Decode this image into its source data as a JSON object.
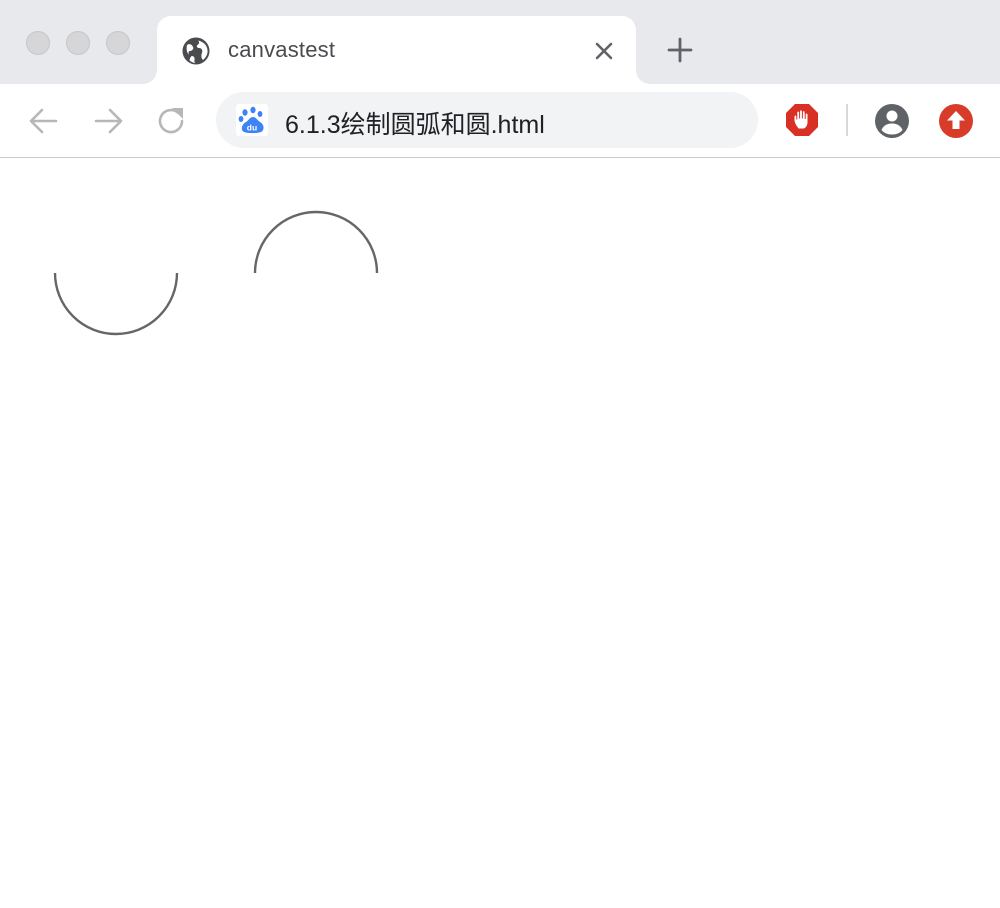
{
  "window": {
    "traffic_lights": [
      "close",
      "minimize",
      "maximize"
    ]
  },
  "tab": {
    "title": "canvastest",
    "favicon": "globe-icon",
    "close_icon": "close-icon"
  },
  "new_tab": {
    "icon": "plus-icon"
  },
  "toolbar": {
    "back_icon": "arrow-left-icon",
    "forward_icon": "arrow-right-icon",
    "reload_icon": "reload-icon",
    "url": "6.1.3绘制圆弧和圆.html",
    "url_favicon": "baidu-paw-icon",
    "extensions": [
      "adblock-hand-icon",
      "upload-arrow-icon"
    ],
    "profile_icon": "account-circle-icon"
  },
  "colors": {
    "tabstrip_bg": "#e8e9ed",
    "omnibox_bg": "#f1f3f4",
    "stroke": "#666666",
    "adblock_red": "#d93025",
    "upload_red": "#d83b2a",
    "baidu_blue": "#3b83f6"
  }
}
